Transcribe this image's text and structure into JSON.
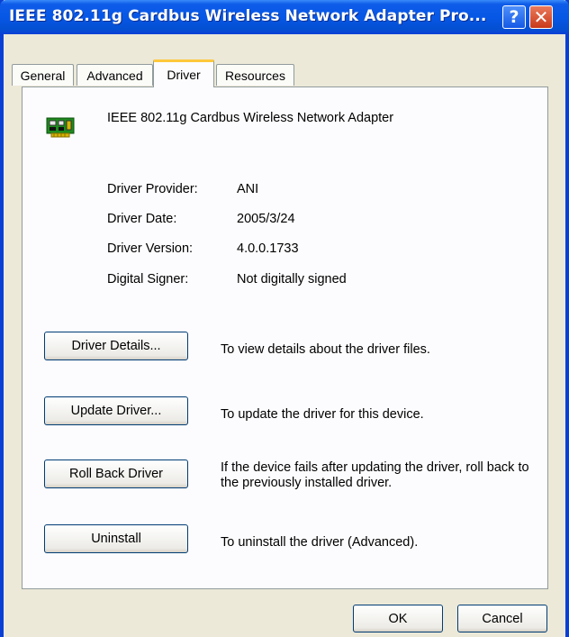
{
  "window": {
    "title": "IEEE 802.11g Cardbus Wireless Network Adapter Pro..."
  },
  "title_buttons": {
    "help": "?",
    "close": "✕"
  },
  "tabs": [
    {
      "label": "General"
    },
    {
      "label": "Advanced"
    },
    {
      "label": "Driver",
      "active": true
    },
    {
      "label": "Resources"
    }
  ],
  "device": {
    "name": "IEEE 802.11g Cardbus Wireless Network Adapter",
    "icon": "network-card-icon"
  },
  "properties": [
    {
      "label": "Driver Provider:",
      "value": "ANI"
    },
    {
      "label": "Driver Date:",
      "value": "2005/3/24"
    },
    {
      "label": "Driver Version:",
      "value": "4.0.0.1733"
    },
    {
      "label": "Digital Signer:",
      "value": "Not digitally signed"
    }
  ],
  "actions": [
    {
      "button": "Driver Details...",
      "description": "To view details about the driver files."
    },
    {
      "button": "Update Driver...",
      "description": "To update the driver for this device."
    },
    {
      "button": "Roll Back Driver",
      "description": "If the device fails after updating the driver, roll back to the previously installed driver."
    },
    {
      "button": "Uninstall",
      "description": "To uninstall the driver (Advanced)."
    }
  ],
  "footer": {
    "ok": "OK",
    "cancel": "Cancel"
  },
  "colors": {
    "titlebar": "#0757e6",
    "tab_highlight": "#ffc83c",
    "dialog_bg": "#ece9d8",
    "panel_bg": "#fcfcfe"
  }
}
